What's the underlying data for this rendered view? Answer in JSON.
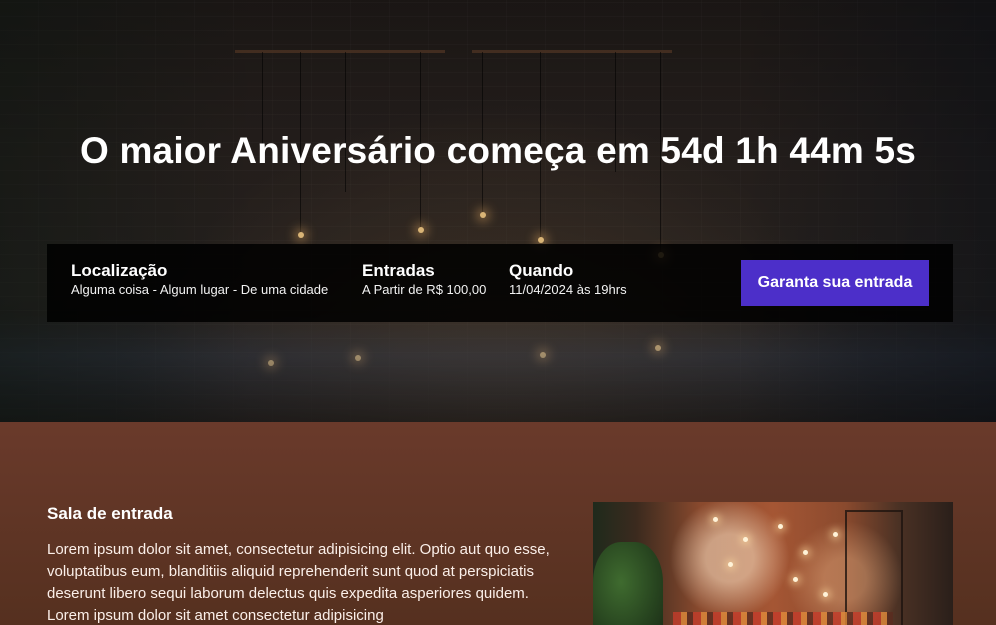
{
  "hero": {
    "title": "O maior Aniversário começa em 54d 1h 44m 5s"
  },
  "info_bar": {
    "location": {
      "label": "Localização",
      "value": "Alguma coisa - Algum lugar - De uma cidade"
    },
    "tickets": {
      "label": "Entradas",
      "value": "A Partir de R$ 100,00"
    },
    "when": {
      "label": "Quando",
      "value": "11/04/2024 às 19hrs"
    },
    "cta_label": "Garanta sua entrada"
  },
  "section": {
    "title": "Sala de entrada",
    "text": "Lorem ipsum dolor sit amet, consectetur adipisicing elit. Optio aut quo esse, voluptatibus eum, blanditiis aliquid reprehenderit sunt quod at perspiciatis deserunt libero sequi laborum delectus quis expedita asperiores quidem. Lorem ipsum dolor sit amet consectetur adipisicing"
  },
  "colors": {
    "cta_button": "#4c2fc9",
    "content_background": "#5a3226",
    "info_bar_background": "#000000"
  }
}
